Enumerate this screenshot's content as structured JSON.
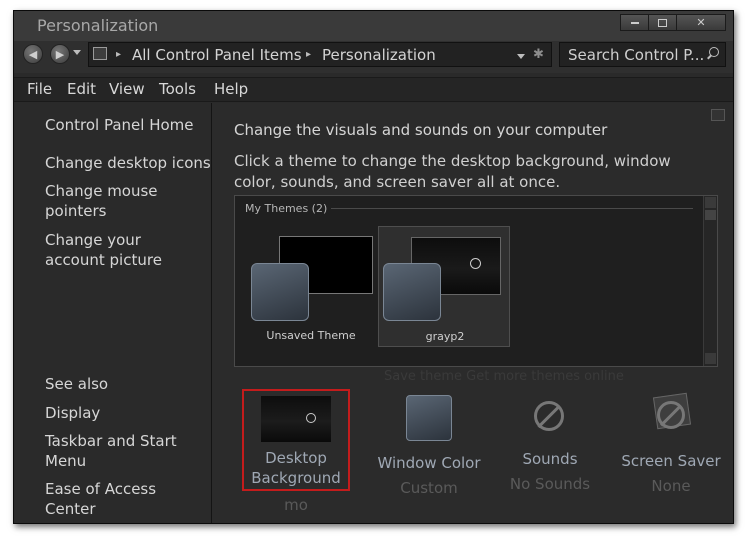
{
  "window": {
    "title": "Personalization"
  },
  "address": {
    "root": "All Control Panel Items",
    "current": "Personalization",
    "sep": "▸"
  },
  "search": {
    "placeholder": "Search Control P..."
  },
  "menu": [
    "File",
    "Edit",
    "View",
    "Tools",
    "Help"
  ],
  "sidebar": {
    "home": "Control Panel Home",
    "links": [
      "Change desktop icons",
      "Change mouse pointers",
      "Change your account picture"
    ],
    "see_also": "See also",
    "see_also_links": [
      "Display",
      "Taskbar and Start Menu",
      "Ease of Access Center"
    ]
  },
  "main": {
    "heading": "Change the visuals and sounds on your computer",
    "description": "Click a theme to change the desktop background, window color, sounds, and screen saver all at once.",
    "group_label": "My Themes (2)",
    "themes": [
      {
        "name": "Unsaved Theme"
      },
      {
        "name": "grayp2"
      }
    ],
    "hidden_text": "Save theme     Get more themes online",
    "tiles": [
      {
        "label": "Desktop Background",
        "sub": "mo"
      },
      {
        "label": "Window Color",
        "sub": "Custom"
      },
      {
        "label": "Sounds",
        "sub": "No Sounds"
      },
      {
        "label": "Screen Saver",
        "sub": "None"
      }
    ]
  },
  "colors": {
    "window_bg": "#2a2a2a",
    "selection_border": "#c41c1c",
    "tile_label": "#9fa8b4"
  }
}
